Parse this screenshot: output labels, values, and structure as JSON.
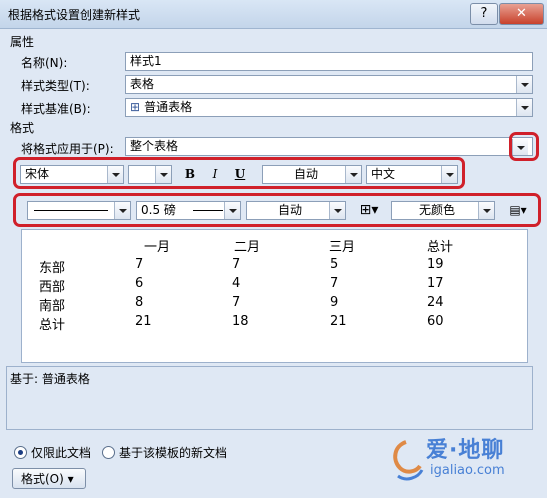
{
  "window": {
    "title": "根据格式设置创建新样式",
    "help": "?",
    "close": "✕"
  },
  "properties": {
    "heading": "属性",
    "name_label": "名称(N):",
    "name_value": "样式1",
    "type_label": "样式类型(T):",
    "type_value": "表格",
    "based_label": "样式基准(B):",
    "based_value": "普通表格"
  },
  "format": {
    "heading": "格式",
    "apply_label": "将格式应用于(P):",
    "apply_value": "整个表格",
    "font_name": "宋体",
    "font_size": "",
    "bold": "B",
    "italic": "I",
    "underline": "U",
    "font_color": "自动",
    "script": "中文",
    "border_weight": "0.5 磅",
    "border_color": "自动",
    "shading": "无颜色"
  },
  "preview": {
    "columns": [
      "",
      "一月",
      "二月",
      "三月",
      "总计"
    ],
    "rows": [
      [
        "东部",
        "7",
        "7",
        "5",
        "19"
      ],
      [
        "西部",
        "6",
        "4",
        "7",
        "17"
      ],
      [
        "南部",
        "8",
        "7",
        "9",
        "24"
      ],
      [
        "总计",
        "21",
        "18",
        "21",
        "60"
      ]
    ]
  },
  "description": "基于: 普通表格",
  "options": {
    "only_this_doc": "仅限此文档",
    "new_docs": "基于该模板的新文档",
    "format_button": "格式(O) ▾"
  },
  "watermark": {
    "brand": "爱·地聊",
    "url": "igaliao.com"
  },
  "colors": {
    "highlight": "#d0202a",
    "dialog_bg": "#dfe8f4"
  }
}
